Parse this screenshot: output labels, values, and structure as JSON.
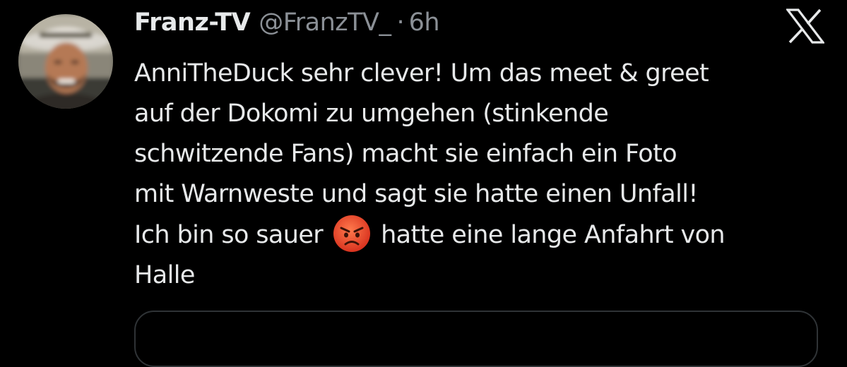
{
  "tweet": {
    "display_name": "Franz-TV",
    "handle": "@FranzTV_",
    "separator": "·",
    "time": "6h",
    "body_lines": [
      "AnniTheDuck sehr clever! Um das meet & greet",
      "auf der Dokomi zu umgehen (stinkende",
      "schwitzende Fans) macht sie einfach ein Foto",
      "mit Warnweste und sagt sie hatte einen Unfall!",
      "Ich bin so sauer",
      "hatte eine lange Anfahrt von",
      "Halle"
    ],
    "emoji": "angry-face"
  },
  "icons": {
    "platform": "x-logo-icon",
    "emoji": "angry-face-icon"
  },
  "colors": {
    "background": "#000000",
    "primary_text": "#e7e9ea",
    "secondary_text": "#8b9096",
    "border": "#2f3336",
    "emoji_face": "#e8442a"
  }
}
